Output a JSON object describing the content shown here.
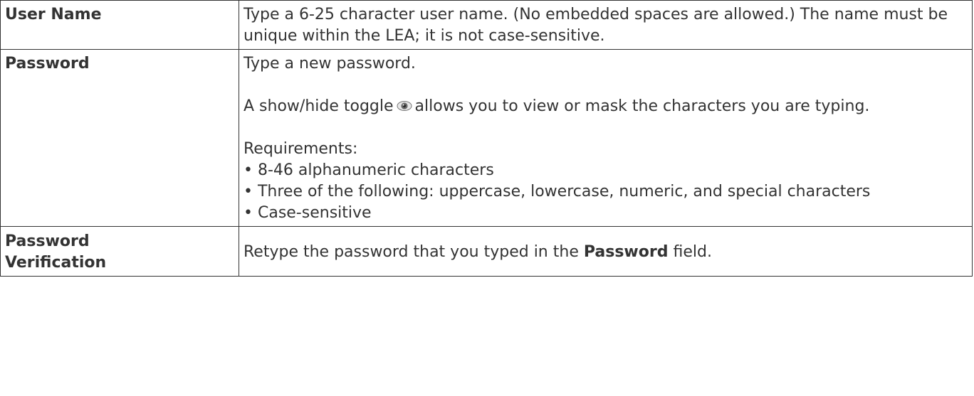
{
  "rows": [
    {
      "field": "User Name",
      "description": "Type a 6-25 character user name. (No embedded spaces are allowed.) The name must be unique within the LEA; it is not case-sensitive."
    },
    {
      "field": "Password",
      "intro": "Type a new password.",
      "toggle_before": "A show/hide toggle",
      "toggle_after": "allows you to view or mask the characters you are typing.",
      "toggle_icon": "eye-icon",
      "requirements_heading": "Requirements:",
      "requirements": [
        "• 8-46 alphanumeric characters",
        "• Three of the following: uppercase, lowercase, numeric, and special characters",
        "• Case-sensitive"
      ]
    },
    {
      "field_line1": "Password",
      "field_line2": "Verification",
      "desc_before": "Retype the password that you typed in the",
      "desc_bold": "Password",
      "desc_after": "field."
    }
  ],
  "colors": {
    "text": "#333333",
    "border": "#333333",
    "eye_icon": "#555555"
  }
}
